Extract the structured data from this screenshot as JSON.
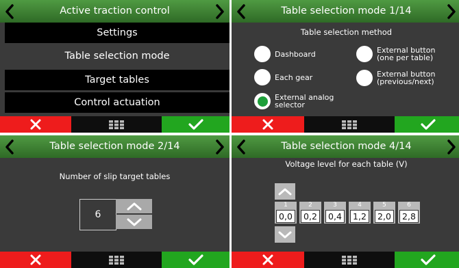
{
  "screens": [
    {
      "title": "Active traction control",
      "menu": [
        "Settings",
        "Table selection mode",
        "Target tables",
        "Control actuation"
      ]
    },
    {
      "title": "Table selection mode 1/14",
      "subtitle": "Table selection method",
      "options": [
        {
          "label": "Dashboard",
          "selected": false
        },
        {
          "label": "External button",
          "label2": "(one per table)",
          "selected": false
        },
        {
          "label": "Each gear",
          "selected": false
        },
        {
          "label": "External button",
          "label2": "(previous/next)",
          "selected": false
        },
        {
          "label": "External analog",
          "label2": "selector",
          "selected": true
        }
      ]
    },
    {
      "title": "Table selection mode 2/14",
      "subtitle": "Number of slip target tables",
      "value": "6"
    },
    {
      "title": "Table selection mode 4/14",
      "subtitle": "Voltage level for each table (V)",
      "tables": [
        {
          "number": "1",
          "value": "0,0"
        },
        {
          "number": "2",
          "value": "0,2"
        },
        {
          "number": "3",
          "value": "0,4"
        },
        {
          "number": "4",
          "value": "1,2"
        },
        {
          "number": "5",
          "value": "2,0"
        },
        {
          "number": "6",
          "value": "2,8"
        }
      ]
    }
  ],
  "icons": {
    "prev": "chevron-left-icon",
    "next": "chevron-right-icon",
    "cancel": "close-icon",
    "menu": "grid-menu-icon",
    "confirm": "checkmark-icon",
    "increase": "chevron-up-icon",
    "decrease": "chevron-down-icon"
  },
  "colors": {
    "header_green": "#3f8a35",
    "cancel_red": "#ee1c1c",
    "confirm_green": "#22a61f",
    "radio_selected": "#1e9f3a"
  }
}
